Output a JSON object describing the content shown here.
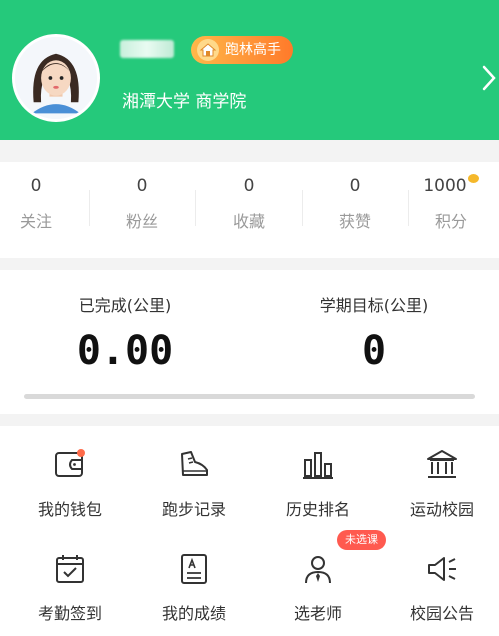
{
  "profile": {
    "badge": "跑林高手",
    "school": "湘潭大学 商学院"
  },
  "stats": [
    {
      "value": "0",
      "label": "关注"
    },
    {
      "value": "0",
      "label": "粉丝"
    },
    {
      "value": "0",
      "label": "收藏"
    },
    {
      "value": "0",
      "label": "获赞"
    },
    {
      "value": "1000",
      "label": "积分"
    }
  ],
  "distance": {
    "completed_label": "已完成(公里)",
    "completed_value": "0.00",
    "goal_label": "学期目标(公里)",
    "goal_value": "0",
    "progress": 0
  },
  "menu": [
    {
      "label": "我的钱包",
      "icon": "wallet-icon"
    },
    {
      "label": "跑步记录",
      "icon": "shoe-icon"
    },
    {
      "label": "历史排名",
      "icon": "bar-chart-icon"
    },
    {
      "label": "运动校园",
      "icon": "campus-building-icon"
    },
    {
      "label": "考勤签到",
      "icon": "calendar-check-icon"
    },
    {
      "label": "我的成绩",
      "icon": "grade-document-icon"
    },
    {
      "label": "选老师",
      "icon": "teacher-icon"
    },
    {
      "label": "校园公告",
      "icon": "announcement-icon"
    }
  ],
  "teacher_pill": "未选课",
  "colors": {
    "header": "#25c97b",
    "badge": "#ff7a2a",
    "pill": "#ff5a4f",
    "dot": "#ff6b4a"
  }
}
